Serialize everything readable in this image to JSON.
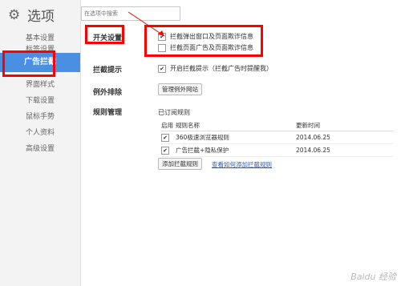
{
  "app": {
    "title": "选项",
    "search_placeholder": "在选项中搜索"
  },
  "sidebar": {
    "items": [
      {
        "label": "基本设置"
      },
      {
        "label": "标签设置"
      },
      {
        "label": "广告拦截"
      },
      {
        "label": "界面样式"
      },
      {
        "label": "下载设置"
      },
      {
        "label": "鼠标手势"
      },
      {
        "label": "个人资料"
      },
      {
        "label": "高级设置"
      }
    ]
  },
  "sections": {
    "switch": {
      "label": "开关设置",
      "opt1": "拦截弹出窗口及页面欺诈信息",
      "opt2": "拦截页面广告及页面欺诈信息"
    },
    "prompt": {
      "label": "拦截提示",
      "opt": "开启拦截提示（拦截广告时提醒我）"
    },
    "exclude": {
      "label": "例外排除",
      "button": "管理例外网站"
    },
    "rules": {
      "label": "规则管理",
      "subscribed": "已订阅规则",
      "headers": [
        "启用",
        "规则名称",
        "更新时间"
      ],
      "rows": [
        {
          "name": "360极速浏览器规则",
          "date": "2014.06.25"
        },
        {
          "name": "广告拦截+隐私保护",
          "date": "2014.06.25"
        }
      ],
      "add_button": "添加拦截规则",
      "help_link": "查看如何添加拦截规则"
    }
  },
  "watermark": "Baidu 经验"
}
